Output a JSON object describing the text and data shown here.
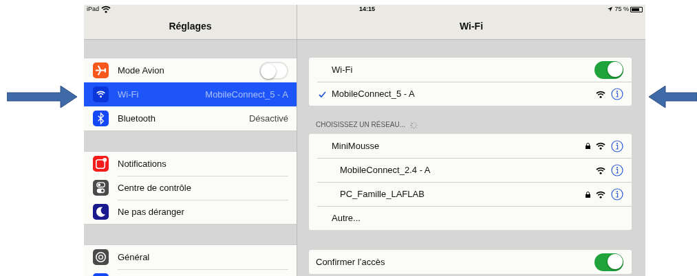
{
  "status_bar": {
    "device": "iPad",
    "time": "14:15",
    "battery": "75 %"
  },
  "sidebar": {
    "title": "Réglages",
    "sections": [
      [
        {
          "kind": "toggle",
          "label": "Mode Avion",
          "color": "#f7581c",
          "on": false,
          "selected": false
        },
        {
          "kind": "value",
          "label": "Wi-Fi",
          "value": "MobileConnect_5 - A",
          "color": "#0b36d9",
          "selected": true
        },
        {
          "kind": "value",
          "label": "Bluetooth",
          "value": "Désactivé",
          "color": "#1447f5",
          "selected": false
        }
      ],
      [
        {
          "kind": "link",
          "label": "Notifications",
          "color": "#f51c1c",
          "selected": false
        },
        {
          "kind": "link",
          "label": "Centre de contrôle",
          "color": "#4a4a4a",
          "selected": false
        },
        {
          "kind": "link",
          "label": "Ne pas déranger",
          "color": "#1a1a8f",
          "selected": false
        }
      ],
      [
        {
          "kind": "link",
          "label": "Général",
          "color": "#4a4a4a",
          "selected": false
        },
        {
          "kind": "link",
          "color": "#1447f5",
          "selected": false
        }
      ]
    ]
  },
  "detail": {
    "title": "Wi-Fi",
    "wifi_toggle": {
      "label": "Wi-Fi",
      "on": true
    },
    "connected": {
      "name": "MobileConnect_5 - A",
      "locked": false
    },
    "networks_header": "CHOISISSEZ UN RÉSEAU...",
    "networks": [
      {
        "name": "MiniMousse",
        "locked": true
      },
      {
        "name": "MobileConnect_2.4 - A",
        "locked": false
      },
      {
        "name": "PC_Famille_LAFLAB",
        "locked": true
      }
    ],
    "other": "Autre...",
    "confirm_toggle": {
      "label": "Confirmer l’accès",
      "on": true
    }
  }
}
